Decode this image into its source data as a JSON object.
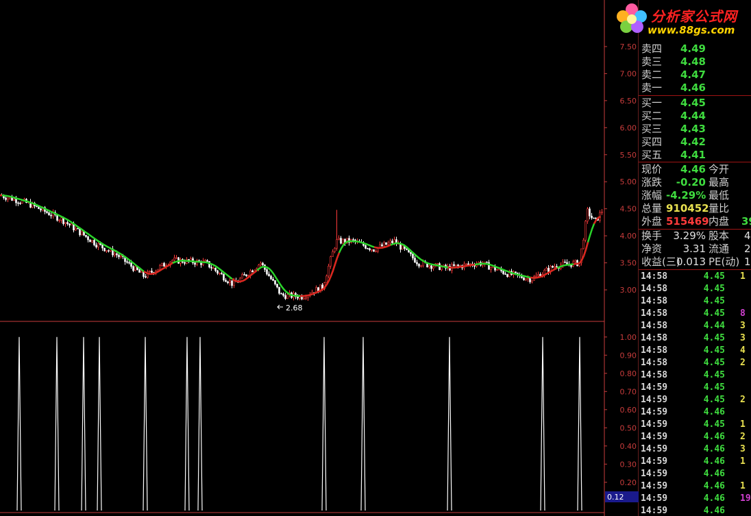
{
  "price_axis": [
    "7.50",
    "7.00",
    "6.50",
    "6.00",
    "5.50",
    "5.00",
    "4.50",
    "4.00",
    "3.50",
    "3.00"
  ],
  "indicator_axis": [
    "1.00",
    "0.90",
    "0.80",
    "0.70",
    "0.60",
    "0.50",
    "0.40",
    "0.30",
    "0.20"
  ],
  "indicator_current": "0.12",
  "low_marker": "2.68",
  "colors": {
    "up": "#ff3b3b",
    "down": "#ffffff",
    "ma_green": "#2ad42a",
    "ma_red": "#e02020",
    "axis": "#c83c3c",
    "green": "#3fdc3f",
    "red": "#ff3b3b",
    "yellow": "#e8e050"
  },
  "order_book": {
    "sell": [
      {
        "label": "卖四",
        "price": "4.49"
      },
      {
        "label": "卖三",
        "price": "4.48"
      },
      {
        "label": "卖二",
        "price": "4.47"
      },
      {
        "label": "卖一",
        "price": "4.46"
      }
    ],
    "buy": [
      {
        "label": "买一",
        "price": "4.45"
      },
      {
        "label": "买二",
        "price": "4.44"
      },
      {
        "label": "买三",
        "price": "4.43"
      },
      {
        "label": "买四",
        "price": "4.42"
      },
      {
        "label": "买五",
        "price": "4.41"
      }
    ]
  },
  "quote": {
    "now_label": "现价",
    "now_val": "4.46",
    "open_label": "今开",
    "chg_label": "涨跌",
    "chg_val": "-0.20",
    "high_label": "最高",
    "pct_label": "涨幅",
    "pct_val": "-4.29%",
    "low_label": "最低",
    "vol_label": "总量",
    "vol_val": "910452",
    "ratio_label": "量比",
    "out_label": "外盘",
    "out_val": "515469",
    "in_label": "内盘",
    "in_val": "39"
  },
  "fundamentals": {
    "turnover_label": "换手",
    "turnover_val": "3.29%",
    "cap_label": "股本",
    "cap_val": "4",
    "nav_label": "净资",
    "nav_val": "3.31",
    "float_label": "流通",
    "float_val": "2",
    "eps_label": "收益(三)",
    "eps_val": "0.013",
    "pe_label": "PE(动)",
    "pe_val": "1"
  },
  "ticks": [
    {
      "time": "14:58",
      "price": "4.45",
      "vol": "1",
      "vcolor": "#e8e050"
    },
    {
      "time": "14:58",
      "price": "4.45",
      "vol": "",
      "vcolor": "#e8e050"
    },
    {
      "time": "14:58",
      "price": "4.45",
      "vol": "",
      "vcolor": "#e8e050"
    },
    {
      "time": "14:58",
      "price": "4.45",
      "vol": "8",
      "vcolor": "#d040d0"
    },
    {
      "time": "14:58",
      "price": "4.44",
      "vol": "3",
      "vcolor": "#e8e050"
    },
    {
      "time": "14:58",
      "price": "4.45",
      "vol": "3",
      "vcolor": "#e8e050"
    },
    {
      "time": "14:58",
      "price": "4.45",
      "vol": "4",
      "vcolor": "#e8e050"
    },
    {
      "time": "14:58",
      "price": "4.45",
      "vol": "2",
      "vcolor": "#e8e050"
    },
    {
      "time": "14:58",
      "price": "4.45",
      "vol": "",
      "vcolor": "#e8e050"
    },
    {
      "time": "14:59",
      "price": "4.45",
      "vol": "",
      "vcolor": "#e8e050"
    },
    {
      "time": "14:59",
      "price": "4.45",
      "vol": "2",
      "vcolor": "#e8e050"
    },
    {
      "time": "14:59",
      "price": "4.46",
      "vol": "",
      "vcolor": "#e8e050"
    },
    {
      "time": "14:59",
      "price": "4.45",
      "vol": "1",
      "vcolor": "#e8e050"
    },
    {
      "time": "14:59",
      "price": "4.46",
      "vol": "2",
      "vcolor": "#e8e050"
    },
    {
      "time": "14:59",
      "price": "4.46",
      "vol": "3",
      "vcolor": "#e8e050"
    },
    {
      "time": "14:59",
      "price": "4.46",
      "vol": "1",
      "vcolor": "#e8e050"
    },
    {
      "time": "14:59",
      "price": "4.46",
      "vol": "",
      "vcolor": "#e8e050"
    },
    {
      "time": "14:59",
      "price": "4.46",
      "vol": "1",
      "vcolor": "#e8e050"
    },
    {
      "time": "14:59",
      "price": "4.46",
      "vol": "19",
      "vcolor": "#d040d0"
    },
    {
      "time": "14:59",
      "price": "4.46",
      "vol": "",
      "vcolor": "#e8e050"
    }
  ],
  "logo": {
    "title": "分析家公式网",
    "url": "www.88gs.com"
  }
}
